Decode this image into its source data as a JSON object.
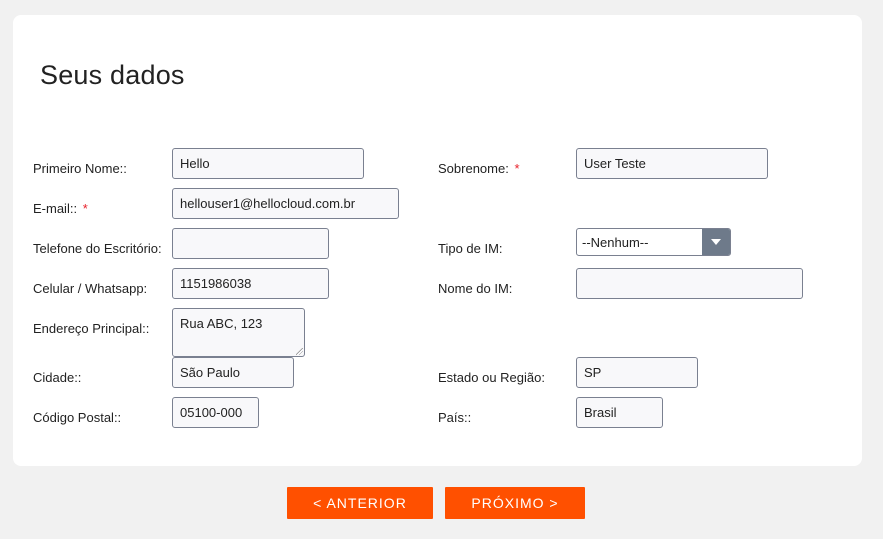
{
  "page": {
    "title": "Seus dados"
  },
  "form": {
    "first_name": {
      "label": "Primeiro Nome::",
      "value": "Hello"
    },
    "last_name": {
      "label": "Sobrenome:",
      "required_mark": "*",
      "value": "User Teste"
    },
    "email": {
      "label": "E-mail::",
      "required_mark": "*",
      "value": "hellouser1@hellocloud.com.br"
    },
    "office_phone": {
      "label": "Telefone do Escritório:",
      "value": ""
    },
    "im_type": {
      "label": "Tipo de IM:",
      "selected": "--Nenhum--"
    },
    "mobile": {
      "label": "Celular / Whatsapp:",
      "value": "1151986038"
    },
    "im_name": {
      "label": "Nome do IM:",
      "value": ""
    },
    "address": {
      "label": "Endereço Principal::",
      "value": "Rua ABC, 123"
    },
    "city": {
      "label": "Cidade::",
      "value": "São Paulo"
    },
    "state": {
      "label": "Estado ou Região:",
      "value": "SP"
    },
    "postal_code": {
      "label": "Código Postal::",
      "value": "05100-000"
    },
    "country": {
      "label": "País::",
      "value": "Brasil"
    }
  },
  "buttons": {
    "previous": "< ANTERIOR",
    "next": "PRÓXIMO >"
  },
  "colors": {
    "accent": "#ff5000",
    "required": "#e8202a",
    "select_arrow_bg": "#6e7a8a"
  }
}
